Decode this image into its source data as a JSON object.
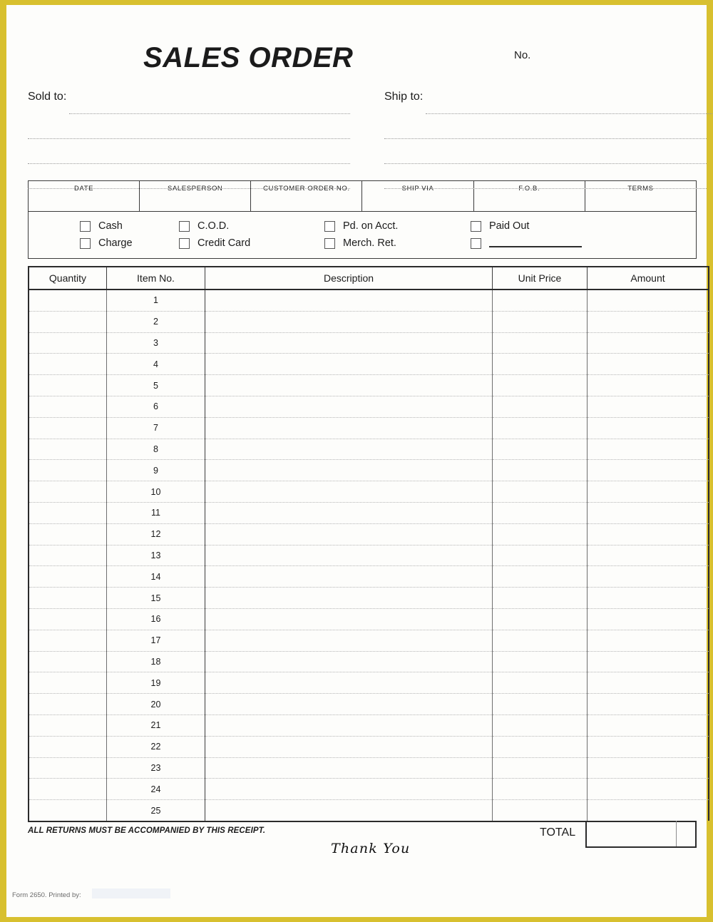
{
  "document": {
    "title": "SALES ORDER",
    "number_label": "No."
  },
  "addresses": {
    "sold_to_label": "Sold to:",
    "ship_to_label": "Ship to:",
    "line_count": 4
  },
  "info_fields": [
    {
      "label": "DATE"
    },
    {
      "label": "SALESPERSON"
    },
    {
      "label": "CUSTOMER ORDER NO."
    },
    {
      "label": "SHIP VIA"
    },
    {
      "label": "F.O.B."
    },
    {
      "label": "TERMS"
    }
  ],
  "payment_options": {
    "row1": [
      {
        "label": "Cash",
        "checked": false
      },
      {
        "label": "C.O.D.",
        "checked": false
      },
      {
        "label": "Pd. on Acct.",
        "checked": false
      },
      {
        "label": "Paid Out",
        "checked": false
      }
    ],
    "row2": [
      {
        "label": "Charge",
        "checked": false
      },
      {
        "label": "Credit Card",
        "checked": false
      },
      {
        "label": "Merch. Ret.",
        "checked": false
      },
      {
        "label": "",
        "checked": false,
        "write_in": true
      }
    ]
  },
  "items_table": {
    "columns": [
      "Quantity",
      "Item No.",
      "Description",
      "Unit Price",
      "Amount"
    ],
    "row_numbers": [
      1,
      2,
      3,
      4,
      5,
      6,
      7,
      8,
      9,
      10,
      11,
      12,
      13,
      14,
      15,
      16,
      17,
      18,
      19,
      20,
      21,
      22,
      23,
      24,
      25
    ]
  },
  "footer": {
    "returns_note": "ALL RETURNS MUST BE ACCOMPANIED BY THIS RECEIPT.",
    "thank_you": "Thank You",
    "total_label": "TOTAL",
    "form_meta": "Form 2650. Printed by:"
  },
  "colors": {
    "frame": "#d8c02f",
    "rule": "#2b2b2b",
    "dotted": "#b5b5b5"
  }
}
